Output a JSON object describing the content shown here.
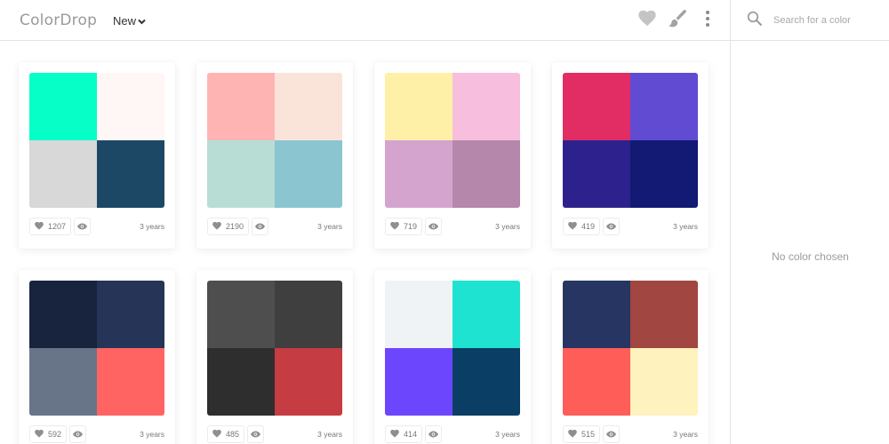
{
  "app": {
    "logo": "ColorDrop"
  },
  "header": {
    "sort_label": "New"
  },
  "search": {
    "placeholder": "Search for a color"
  },
  "sidebar": {
    "empty_message": "No color chosen"
  },
  "palettes": [
    {
      "colors": [
        "#06ffc6",
        "#fff7f5",
        "#d8d8d8",
        "#1c4866"
      ],
      "likes": "1207",
      "age": "3 years"
    },
    {
      "colors": [
        "#ffb4b4",
        "#fae4da",
        "#b8ddd5",
        "#8bc5d0"
      ],
      "likes": "2190",
      "age": "3 years"
    },
    {
      "colors": [
        "#fff0a8",
        "#f8bede",
        "#d4a4cf",
        "#b487ab"
      ],
      "likes": "719",
      "age": "3 years"
    },
    {
      "colors": [
        "#e22c64",
        "#614bd3",
        "#2d228d",
        "#121a74"
      ],
      "likes": "419",
      "age": "3 years"
    },
    {
      "colors": [
        "#18233e",
        "#263557",
        "#687488",
        "#ff6463"
      ],
      "likes": "592",
      "age": "3 years"
    },
    {
      "colors": [
        "#4e4e4e",
        "#3f3f3f",
        "#2e2e2e",
        "#c53c42"
      ],
      "likes": "485",
      "age": "3 years"
    },
    {
      "colors": [
        "#eff3f5",
        "#1ee3d1",
        "#6c46fd",
        "#0b3e65"
      ],
      "likes": "414",
      "age": "3 years"
    },
    {
      "colors": [
        "#263561",
        "#a14640",
        "#ff5d57",
        "#fef2bf"
      ],
      "likes": "515",
      "age": "3 years"
    }
  ],
  "colors": {
    "icon_gray": "#bcbcbc",
    "meta_icon": "#8f8f8f",
    "divider": "#e3e3e3"
  }
}
